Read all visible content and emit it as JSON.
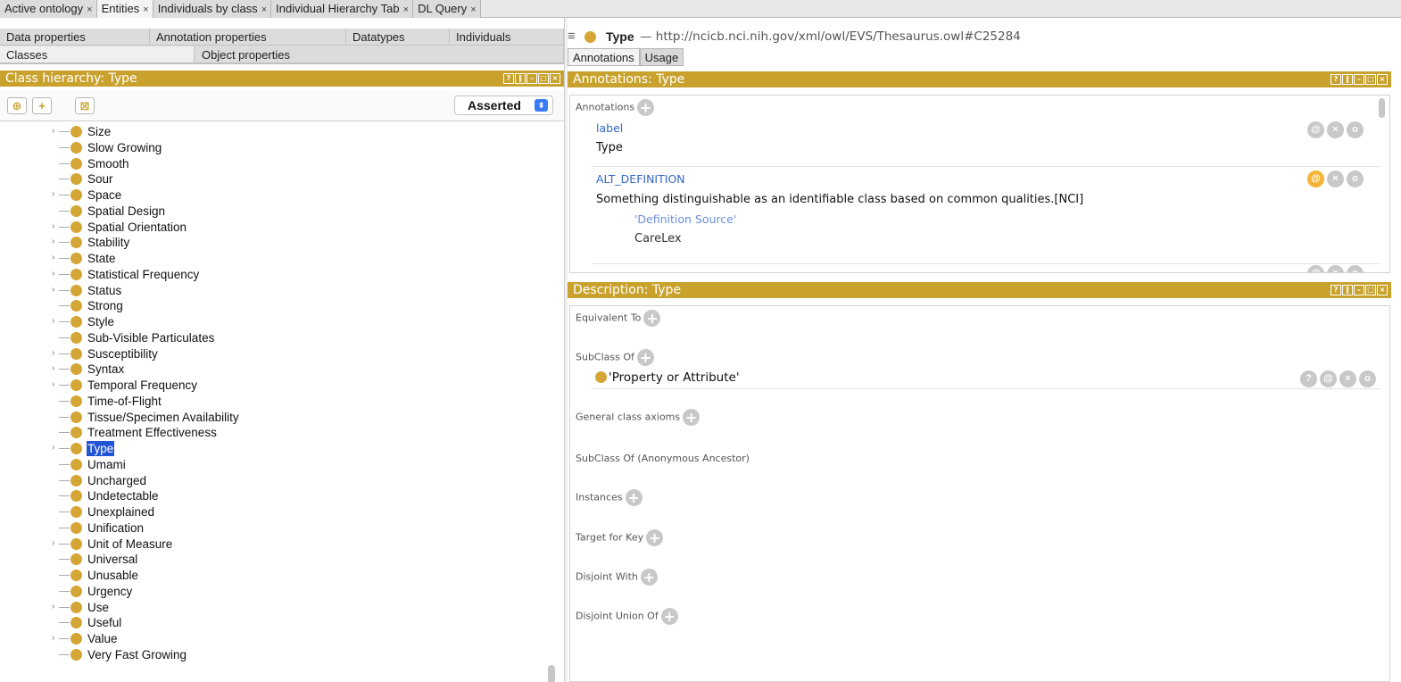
{
  "main_tabs": [
    {
      "label": "Active ontology",
      "close": "×"
    },
    {
      "label": "Entities",
      "close": "×"
    },
    {
      "label": "Individuals by class",
      "close": "×"
    },
    {
      "label": "Individual Hierarchy Tab",
      "close": "×"
    },
    {
      "label": "DL Query",
      "close": "×"
    }
  ],
  "left": {
    "subtabs_row1": [
      "Data properties",
      "Annotation properties",
      "Datatypes",
      "Individuals"
    ],
    "subtabs_row2": [
      "Classes",
      "Object properties"
    ],
    "panel_title": "Class hierarchy: Type",
    "view_mode": "Asserted",
    "tree": [
      {
        "label": "Size",
        "expandable": true
      },
      {
        "label": "Slow Growing",
        "expandable": false
      },
      {
        "label": "Smooth",
        "expandable": false
      },
      {
        "label": "Sour",
        "expandable": false
      },
      {
        "label": "Space",
        "expandable": true
      },
      {
        "label": "Spatial Design",
        "expandable": false
      },
      {
        "label": "Spatial Orientation",
        "expandable": true
      },
      {
        "label": "Stability",
        "expandable": true
      },
      {
        "label": "State",
        "expandable": true
      },
      {
        "label": "Statistical Frequency",
        "expandable": true
      },
      {
        "label": "Status",
        "expandable": true
      },
      {
        "label": "Strong",
        "expandable": false
      },
      {
        "label": "Style",
        "expandable": true
      },
      {
        "label": "Sub-Visible Particulates",
        "expandable": false
      },
      {
        "label": "Susceptibility",
        "expandable": true
      },
      {
        "label": "Syntax",
        "expandable": true
      },
      {
        "label": "Temporal Frequency",
        "expandable": true
      },
      {
        "label": "Time-of-Flight",
        "expandable": false
      },
      {
        "label": "Tissue/Specimen Availability",
        "expandable": false
      },
      {
        "label": "Treatment Effectiveness",
        "expandable": false
      },
      {
        "label": "Type",
        "expandable": true,
        "selected": true
      },
      {
        "label": "Umami",
        "expandable": false
      },
      {
        "label": "Uncharged",
        "expandable": false
      },
      {
        "label": "Undetectable",
        "expandable": false
      },
      {
        "label": "Unexplained",
        "expandable": false
      },
      {
        "label": "Unification",
        "expandable": false
      },
      {
        "label": "Unit of Measure",
        "expandable": true
      },
      {
        "label": "Universal",
        "expandable": false
      },
      {
        "label": "Unusable",
        "expandable": false
      },
      {
        "label": "Urgency",
        "expandable": false
      },
      {
        "label": "Use",
        "expandable": true
      },
      {
        "label": "Useful",
        "expandable": false
      },
      {
        "label": "Value",
        "expandable": true
      },
      {
        "label": "Very Fast Growing",
        "expandable": false
      }
    ]
  },
  "entity": {
    "name": "Type",
    "iri": "— http://ncicb.nci.nih.gov/xml/owl/EVS/Thesaurus.owl#C25284"
  },
  "right_tabs": [
    "Annotations",
    "Usage"
  ],
  "annotations": {
    "panel_title": "Annotations: Type",
    "section_label": "Annotations",
    "items": [
      {
        "property": "label",
        "value": "Type"
      },
      {
        "property": "ALT_DEFINITION",
        "value": "Something distinguishable as an identifiable class based on common qualities.[NCI]",
        "sub_property": "'Definition Source'",
        "sub_value": "CareLex"
      }
    ]
  },
  "description": {
    "panel_title": "Description: Type",
    "sections": {
      "equivalent_to": "Equivalent To",
      "subclass_of": "SubClass Of",
      "general_axioms": "General class axioms",
      "anon_ancestor": "SubClass Of (Anonymous Ancestor)",
      "instances": "Instances",
      "target_for_key": "Target for Key",
      "disjoint_with": "Disjoint With",
      "disjoint_union": "Disjoint Union Of"
    },
    "superclass": "'Property or Attribute'"
  },
  "icons": {
    "plus": "+",
    "annotate": "@",
    "delete": "×",
    "edit": "o",
    "explain": "?",
    "menu": "≡",
    "dropdown": "⬍"
  },
  "colors": {
    "class_dot": "#d3a636",
    "title_bar": "#c9a22e",
    "selection": "#2155d6",
    "annotation_property": "#3366cc"
  }
}
